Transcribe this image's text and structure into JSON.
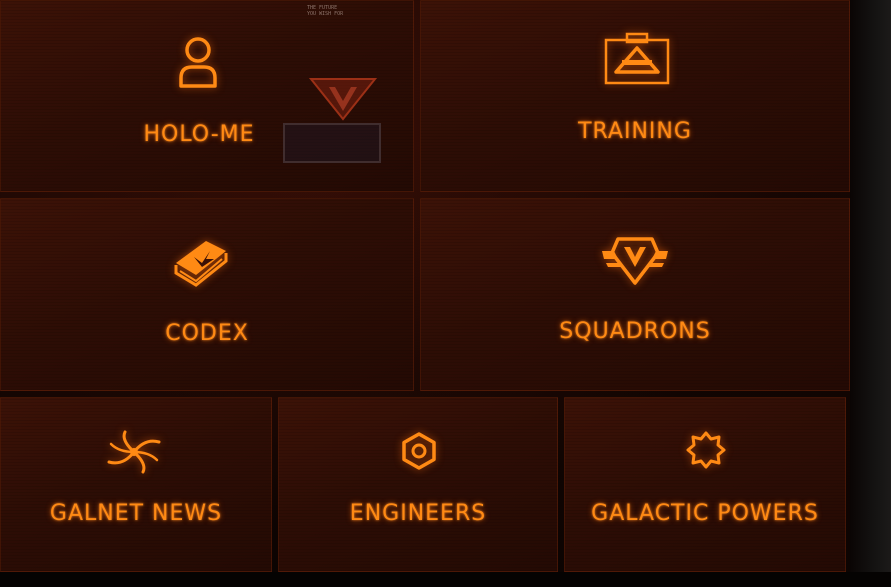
{
  "menu": {
    "tiles": [
      {
        "id": "holo-me",
        "label": "HOLO-ME",
        "icon": "person-icon"
      },
      {
        "id": "training",
        "label": "TRAINING",
        "icon": "training-clipboard-icon"
      },
      {
        "id": "codex",
        "label": "CODEX",
        "icon": "codex-book-icon"
      },
      {
        "id": "squadrons",
        "label": "SQUADRONS",
        "icon": "squadron-emblem-icon"
      },
      {
        "id": "galnet-news",
        "label": "GALNET NEWS",
        "icon": "galaxy-spiral-icon"
      },
      {
        "id": "engineers",
        "label": "ENGINEERS",
        "icon": "engineer-hex-bolt-icon"
      },
      {
        "id": "galactic-powers",
        "label": "GALACTIC POWERS",
        "icon": "power-star-icon"
      }
    ]
  },
  "background": {
    "poster_text": "THE FUTURE\nYOU WISH FOR"
  },
  "colors": {
    "accent": "#ff8a14",
    "tile_bg": "#2d0d05",
    "frame": "#060302"
  }
}
